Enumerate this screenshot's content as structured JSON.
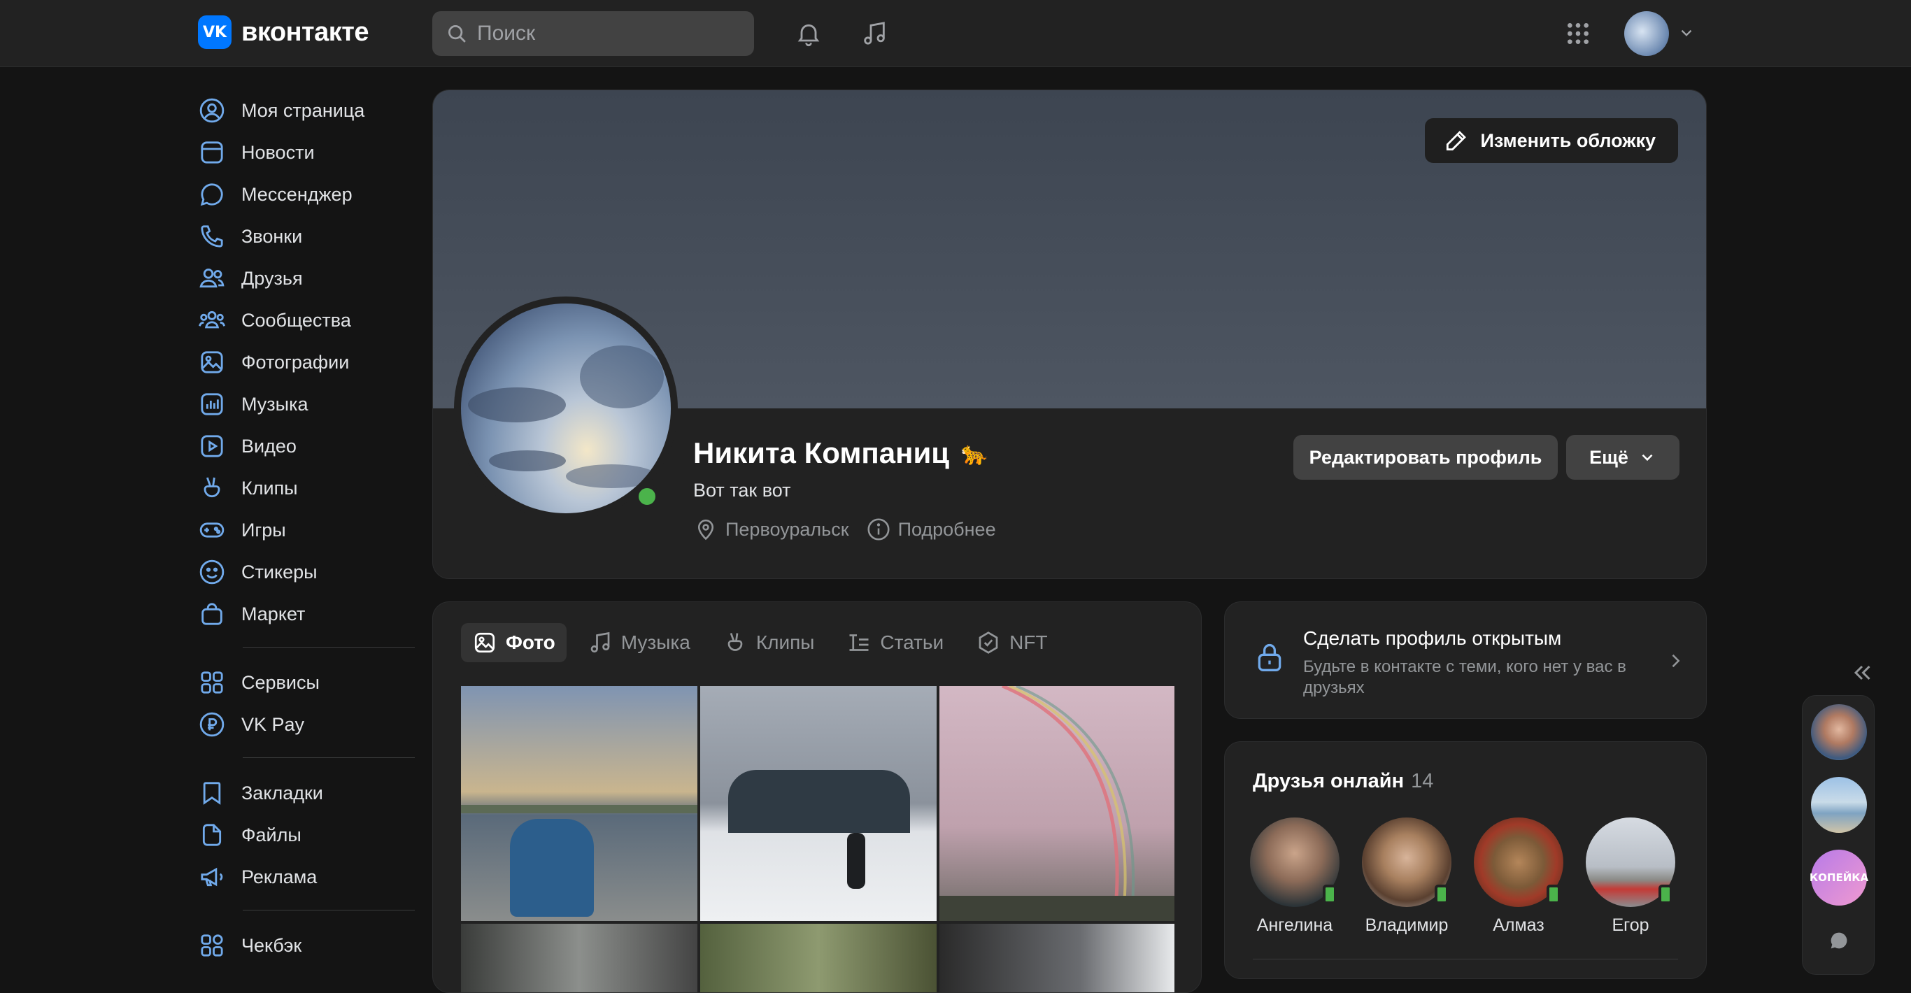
{
  "header": {
    "logo_text": "вконтакте",
    "logo_badge": "VK",
    "search_placeholder": "Поиск"
  },
  "sidebar": {
    "items": [
      {
        "label": "Моя страница",
        "icon": "user-circle-icon"
      },
      {
        "label": "Новости",
        "icon": "newsfeed-icon"
      },
      {
        "label": "Мессенджер",
        "icon": "message-icon"
      },
      {
        "label": "Звонки",
        "icon": "phone-icon"
      },
      {
        "label": "Друзья",
        "icon": "friends-icon"
      },
      {
        "label": "Сообщества",
        "icon": "communities-icon"
      },
      {
        "label": "Фотографии",
        "icon": "picture-icon"
      },
      {
        "label": "Музыка",
        "icon": "music-icon"
      },
      {
        "label": "Видео",
        "icon": "video-icon"
      },
      {
        "label": "Клипы",
        "icon": "clips-icon"
      },
      {
        "label": "Игры",
        "icon": "gamepad-icon"
      },
      {
        "label": "Стикеры",
        "icon": "smile-icon"
      },
      {
        "label": "Маркет",
        "icon": "bag-icon"
      }
    ],
    "services": [
      {
        "label": "Сервисы",
        "icon": "services-icon"
      },
      {
        "label": "VK Pay",
        "icon": "ruble-icon"
      }
    ],
    "extra": [
      {
        "label": "Закладки",
        "icon": "bookmark-icon"
      },
      {
        "label": "Файлы",
        "icon": "file-icon"
      },
      {
        "label": "Реклама",
        "icon": "megaphone-icon"
      }
    ],
    "bottom": [
      {
        "label": "Чекбэк",
        "icon": "checkback-icon"
      }
    ]
  },
  "profile": {
    "change_cover_label": "Изменить обложку",
    "name": "Никита Компаниц",
    "name_emoji": "🐆",
    "status": "Вот так вот",
    "city": "Первоуральск",
    "details_label": "Подробнее",
    "edit_label": "Редактировать профиль",
    "more_label": "Ещё"
  },
  "media_tabs": [
    {
      "label": "Фото",
      "icon": "photo-icon",
      "active": true
    },
    {
      "label": "Музыка",
      "icon": "music-note-icon",
      "active": false
    },
    {
      "label": "Клипы",
      "icon": "clips-icon",
      "active": false
    },
    {
      "label": "Статьи",
      "icon": "articles-icon",
      "active": false
    },
    {
      "label": "NFT",
      "icon": "nft-icon",
      "active": false
    }
  ],
  "open_profile": {
    "title": "Сделать профиль открытым",
    "subtitle": "Будьте в контакте с теми, кого нет у вас в друзьях"
  },
  "friends_online": {
    "title": "Друзья онлайн",
    "count": "14",
    "friends": [
      {
        "name": "Ангелина"
      },
      {
        "name": "Владимир"
      },
      {
        "name": "Алмаз"
      },
      {
        "name": "Егор"
      }
    ]
  },
  "chat_bar": {
    "third_avatar_text": "КОПЕЙКА"
  },
  "colors": {
    "accent": "#0077ff",
    "online": "#4bb34b",
    "background": "#141414",
    "card": "#222222"
  }
}
